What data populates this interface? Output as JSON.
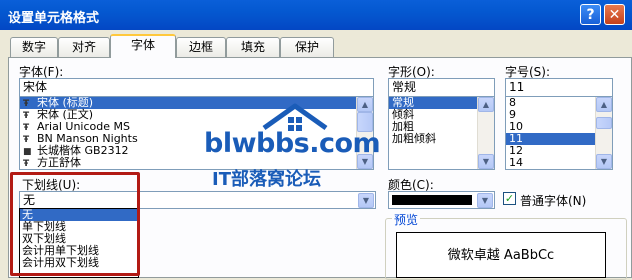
{
  "window": {
    "title": "设置单元格格式"
  },
  "tabs": [
    "数字",
    "对齐",
    "字体",
    "边框",
    "填充",
    "保护"
  ],
  "font": {
    "label": "字体(F):",
    "value": "宋体",
    "items": [
      "宋体 (标题)",
      "宋体 (正文)",
      "Arial Unicode MS",
      "BN Manson Nights",
      "长城楷体 GB2312",
      "方正舒体"
    ]
  },
  "style": {
    "label": "字形(O):",
    "value": "常规",
    "items": [
      "常规",
      "倾斜",
      "加粗",
      "加粗倾斜"
    ]
  },
  "size": {
    "label": "字号(S):",
    "value": "11",
    "items": [
      "8",
      "9",
      "10",
      "11",
      "12",
      "14"
    ]
  },
  "underline": {
    "label": "下划线(U):",
    "value": "无",
    "options": [
      "无",
      "单下划线",
      "双下划线",
      "会计用单下划线",
      "会计用双下划线"
    ]
  },
  "color": {
    "label": "颜色(C):",
    "swatch": "#000000"
  },
  "normal_font": {
    "label": "普通字体(N)",
    "checked": true
  },
  "preview": {
    "label": "预览",
    "text": "微软卓越  AaBbCc"
  },
  "watermark": {
    "brand": "blwbbs.com",
    "sub": "IT部落窝论坛"
  },
  "colors": {
    "title_bar": "#0458d0",
    "selection": "#316ac5",
    "highlight_box": "#b21a14",
    "watermark": "#1a5cb8"
  }
}
